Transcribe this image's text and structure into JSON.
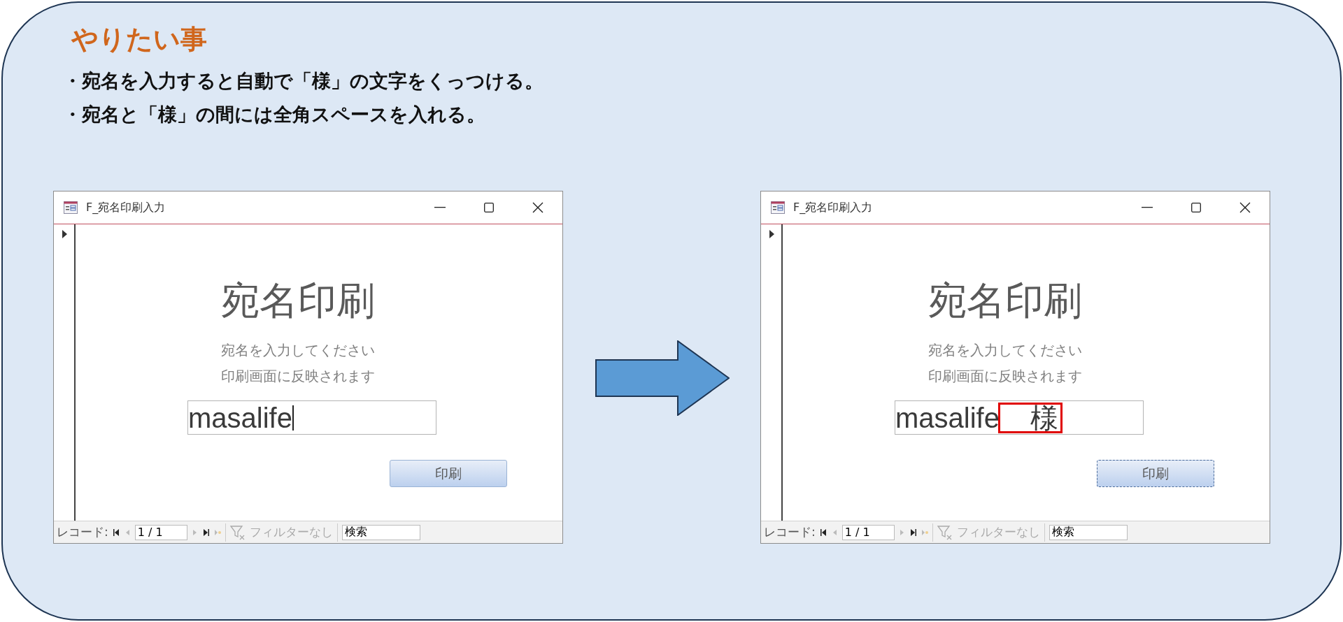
{
  "heading": "やりたい事",
  "bullets": [
    "・宛名を入力すると自動で「様」の文字をくっつける。",
    "・宛名と「様」の間には全角スペースを入れる。"
  ],
  "windows": [
    {
      "title": "F_宛名印刷入力",
      "form_heading": "宛名印刷",
      "instructions": [
        "宛名を入力してください",
        "印刷画面に反映されます"
      ],
      "address_field": {
        "segments": [
          {
            "text": "masalife",
            "highlighted": false
          }
        ],
        "caret": true
      },
      "print_button": {
        "label": "印刷",
        "focused": false
      },
      "navigation": {
        "label": "レコード:",
        "position": "1 / 1",
        "filter": "フィルターなし",
        "search": "検索"
      }
    },
    {
      "title": "F_宛名印刷入力",
      "form_heading": "宛名印刷",
      "instructions": [
        "宛名を入力してください",
        "印刷画面に反映されます"
      ],
      "address_field": {
        "segments": [
          {
            "text": "masalife",
            "highlighted": false
          },
          {
            "text": "　様",
            "highlighted": true
          }
        ],
        "caret": false
      },
      "print_button": {
        "label": "印刷",
        "focused": true
      },
      "navigation": {
        "label": "レコード:",
        "position": "1 / 1",
        "filter": "フィルターなし",
        "search": "検索"
      }
    }
  ]
}
